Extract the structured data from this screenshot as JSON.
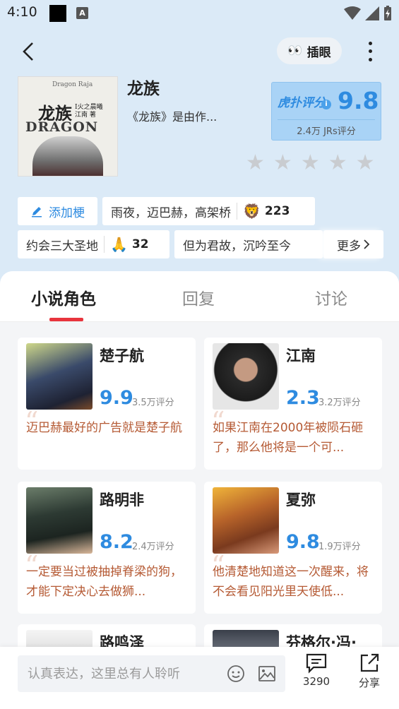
{
  "status_bar": {
    "time": "4:10",
    "a_label": "A"
  },
  "header": {
    "eyes_icon": "👀",
    "eyes_label": "插眼"
  },
  "book": {
    "title": "龙族",
    "description": "《龙族》是由作...",
    "cover_top_text": "Dragon Raja",
    "cover_title": "龙族",
    "cover_roman": "I",
    "cover_sub": "火之晨曦",
    "cover_author": "江南 著",
    "cover_en": "DRAGON"
  },
  "score": {
    "brand": "虎扑评分",
    "value": "9.8",
    "count_text": "2.4万 JRs评分",
    "stars_total": 5,
    "stars_filled": 0
  },
  "tags": {
    "add_label": "添加梗",
    "items": [
      {
        "text": "雨夜，迈巴赫，高架桥",
        "emoji": "🦁",
        "count": "223"
      },
      {
        "text": "约会三大圣地",
        "emoji": "🙏",
        "count": "32"
      },
      {
        "text": "但为君故，沉吟至今",
        "emoji": "",
        "count": ""
      }
    ],
    "more_label": "更多"
  },
  "tabs": [
    {
      "label": "小说角色",
      "active": true
    },
    {
      "label": "回复",
      "active": false
    },
    {
      "label": "讨论",
      "active": false
    }
  ],
  "characters": [
    {
      "name": "楚子航",
      "rating": "9.9",
      "count": "3.5万评分",
      "quote": "迈巴赫最好的广告就是楚子航"
    },
    {
      "name": "江南",
      "rating": "2.3",
      "count": "3.2万评分",
      "quote": "如果江南在2000年被陨石砸了，那么他将是一个可..."
    },
    {
      "name": "路明非",
      "rating": "8.2",
      "count": "2.4万评分",
      "quote": "一定要当过被抽掉脊梁的狗，才能下定决心去做狮..."
    },
    {
      "name": "夏弥",
      "rating": "9.8",
      "count": "1.9万评分",
      "quote": "他清楚地知道这一次醒来，将不会看见阳光里天使低..."
    },
    {
      "name": "路鸣泽",
      "rating": "",
      "count": "",
      "quote": ""
    },
    {
      "name": "芬格尔·冯·",
      "rating": "",
      "count": "",
      "quote": ""
    }
  ],
  "bottom_bar": {
    "input_placeholder": "认真表达，这里总有人聆听",
    "comment_count": "3290",
    "share_label": "分享"
  },
  "colors": {
    "accent_blue": "#2e8be0",
    "tab_underline": "#e8343d",
    "quote_text": "#b55a34",
    "header_bg": "#dbeaf7"
  }
}
